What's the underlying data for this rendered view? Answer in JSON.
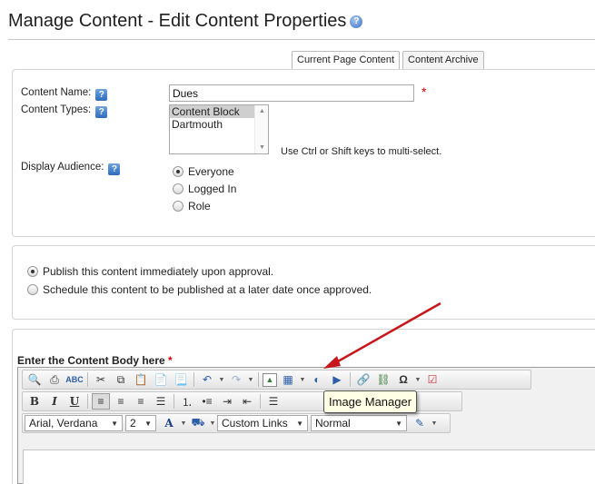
{
  "header": {
    "title": "Manage Content - Edit Content Properties",
    "help_icon": "help-circle-icon"
  },
  "tabs": [
    {
      "label": "Current Page Content",
      "active": true
    },
    {
      "label": "Content Archive",
      "active": false
    }
  ],
  "properties": {
    "content_name_label": "Content Name:",
    "content_name_value": "Dues",
    "content_types_label": "Content Types:",
    "content_types_options": [
      "Content Block",
      "Dartmouth"
    ],
    "content_types_selected": "Content Block",
    "multi_select_hint": "Use Ctrl or Shift keys to multi-select.",
    "display_audience_label": "Display Audience:",
    "audience_options": [
      "Everyone",
      "Logged In",
      "Role"
    ],
    "audience_selected": "Everyone",
    "required_mark": "*",
    "help_glyph": "?"
  },
  "publish": {
    "options": [
      "Publish this content immediately upon approval.",
      "Schedule this content to be published at a later date once approved."
    ],
    "selected": 0
  },
  "editor": {
    "heading": "Enter the Content Body here",
    "required_mark": "*",
    "font_family": "Arial, Verdana",
    "font_size": "2",
    "links": "Custom Links",
    "paragraph_style": "Normal",
    "tooltip": "Image Manager"
  },
  "colors": {
    "accent_blue": "#2f6bbf",
    "required_red": "#dd0000",
    "annotation_arrow": "#c8161d",
    "tooltip_bg": "#ffffe6"
  }
}
